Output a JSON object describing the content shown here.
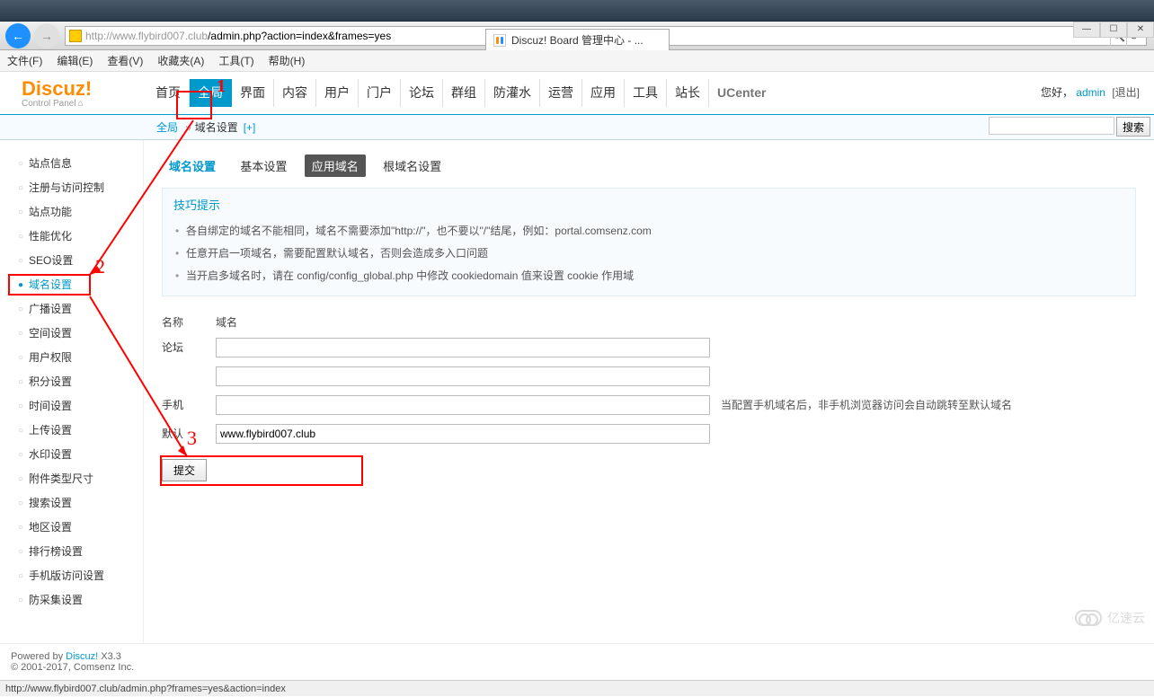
{
  "browser": {
    "url_host": "http://www.flybird007.club",
    "url_path": "/admin.php?action=index&frames=yes",
    "tab_title": "Discuz! Board 管理中心 - ...",
    "menu": [
      "文件(F)",
      "编辑(E)",
      "查看(V)",
      "收藏夹(A)",
      "工具(T)",
      "帮助(H)"
    ],
    "status_url": "http://www.flybird007.club/admin.php?frames=yes&action=index"
  },
  "header": {
    "logo_main": "Discuz!",
    "logo_sub": "Control Panel",
    "nav": [
      "首页",
      "全局",
      "界面",
      "内容",
      "用户",
      "门户",
      "论坛",
      "群组",
      "防灌水",
      "运营",
      "应用",
      "工具",
      "站长",
      "UCenter"
    ],
    "nav_active_index": 1,
    "greeting": "您好，",
    "username": "admin",
    "logout": "[退出]"
  },
  "breadcrumb": {
    "root": "全局",
    "current": "域名设置",
    "plus": "[+]",
    "search_btn": "搜索"
  },
  "sidebar": {
    "items": [
      "站点信息",
      "注册与访问控制",
      "站点功能",
      "性能优化",
      "SEO设置",
      "域名设置",
      "广播设置",
      "空间设置",
      "用户权限",
      "积分设置",
      "时间设置",
      "上传设置",
      "水印设置",
      "附件类型尺寸",
      "搜索设置",
      "地区设置",
      "排行榜设置",
      "手机版访问设置",
      "防采集设置"
    ],
    "active_index": 5
  },
  "tabs": {
    "title": "域名设置",
    "items": [
      "基本设置",
      "应用域名",
      "根域名设置"
    ],
    "active_index": 1
  },
  "tips": {
    "heading": "技巧提示",
    "lines": [
      "各自绑定的域名不能相同，域名不需要添加\"http://\"，也不要以\"/\"结尾，例如：portal.comsenz.com",
      "任意开启一项域名，需要配置默认域名，否则会造成多入口问题",
      "当开启多域名时，请在 config/config_global.php 中修改 cookiedomain 值来设置 cookie 作用域"
    ]
  },
  "table": {
    "col_name": "名称",
    "col_domain": "域名",
    "rows": [
      {
        "label": "论坛",
        "value": "",
        "note": ""
      },
      {
        "label": "",
        "value": "",
        "note": ""
      },
      {
        "label": "手机",
        "value": "",
        "note": "当配置手机域名后，非手机浏览器访问会自动跳转至默认域名"
      },
      {
        "label": "默认",
        "value": "www.flybird007.club",
        "note": ""
      }
    ],
    "submit": "提交"
  },
  "footer": {
    "line1_a": "Powered by ",
    "line1_b": "Discuz!",
    "line1_c": " X3.3",
    "line2": "© 2001-2017, Comsenz Inc."
  },
  "watermark": "亿速云"
}
